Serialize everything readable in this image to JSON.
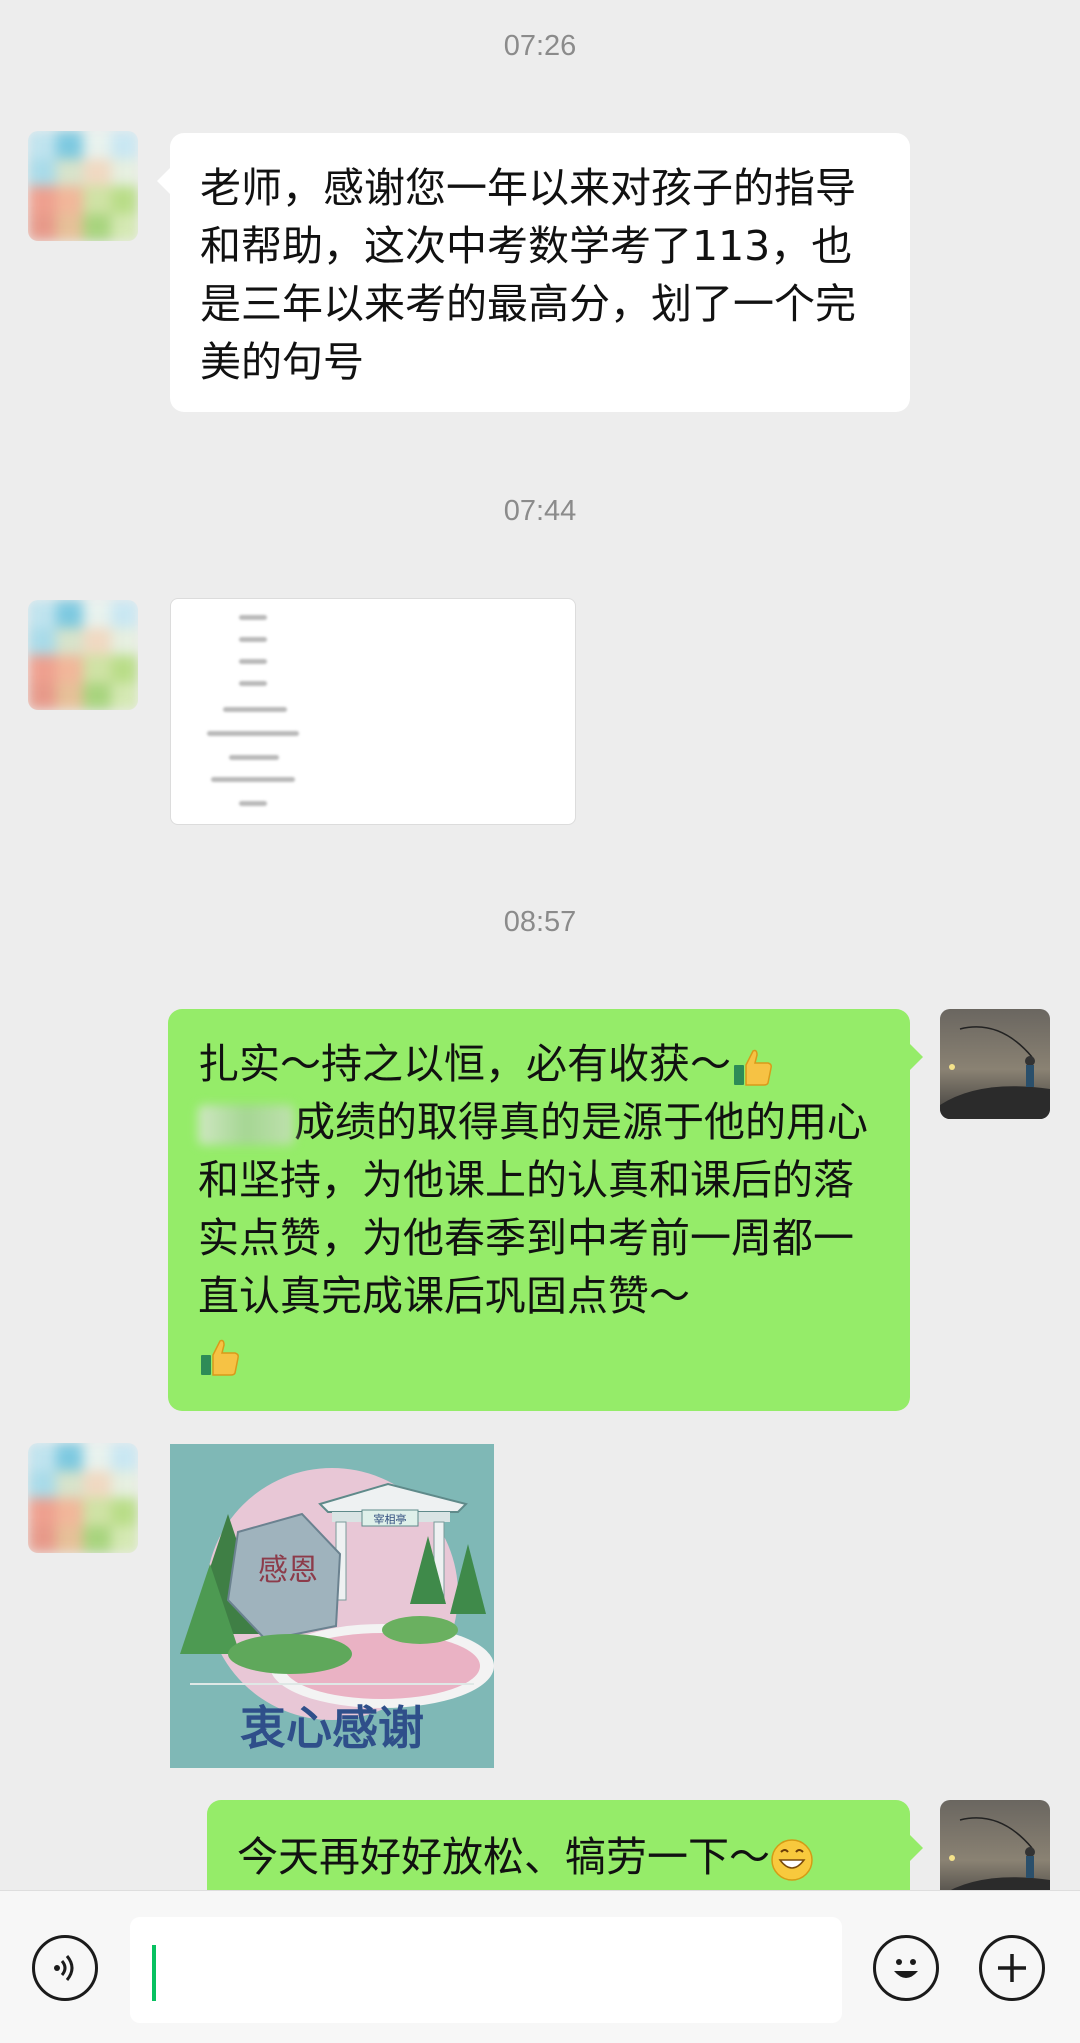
{
  "timestamps": [
    "07:26",
    "07:44",
    "08:57"
  ],
  "messages": {
    "m1": "老师，感谢您一年以来对孩子的指导和帮助，这次中考数学考了113，也是三年以来考的最高分，划了一个完美的句号",
    "m3_line1": "扎实～持之以恒，必有收获～",
    "m3_body": "成绩的取得真的是源于他的用心和坚持，为他课上的认真和课后的落实点赞，为他春季到中考前一周都一直认真完成课后巩固点赞～",
    "m5": "今天再好好放松、犒劳一下～"
  },
  "sticker": {
    "stone_text": "感恩",
    "sign_text": "宰相亭",
    "caption": "衷心感谢"
  },
  "icons": {
    "thumbs": "thumbs-up-emoji",
    "grin": "grinning-emoji",
    "voice": "voice-icon",
    "emoji": "emoji-icon",
    "plus": "plus-icon"
  },
  "colors": {
    "received_bubble": "#ffffff",
    "sent_bubble": "#95ec69",
    "background": "#ededed",
    "cursor": "#07c160"
  }
}
